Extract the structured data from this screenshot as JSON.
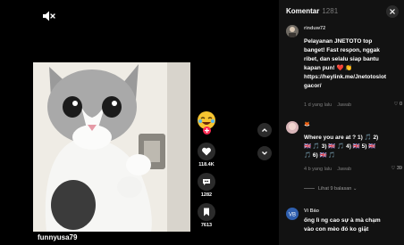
{
  "video": {
    "username": "funnyusa79"
  },
  "actions": {
    "likes": "118.4K",
    "comments": "1282",
    "saves": "7613"
  },
  "comments_panel": {
    "title": "Komentar",
    "count": "1281",
    "comments": [
      {
        "name": "rinduw72",
        "text": "Pelayanan JNETOTO top\nbanget! Fast respon, nggak\nribet, dan selalu siap bantu\nkapan pun! ❤️ 👏\nhttps://heylink.me/Jnetotoslot\ngacor/",
        "time": "1 d yang lalu",
        "reply": "Jawab",
        "likes": "0"
      },
      {
        "name": "🦊",
        "text": "Where you are at ? 1) 🎵 2)\n🇬🇧 🎵 3) 🇬🇧 🎵 4) 🇬🇧 5) 🇬🇧\n🎵 6) 🇬🇧 🎵",
        "time": "4 b yang lalu",
        "reply": "Jawab",
        "likes": "39"
      },
      {
        "name": "Vi Bảo",
        "text": "ống lì ng cao sự à mà chạm\nvào con mèo đó ko giặt",
        "time": "",
        "reply": "",
        "likes": ""
      }
    ],
    "view_replies": "Lihat 9 balasan"
  }
}
